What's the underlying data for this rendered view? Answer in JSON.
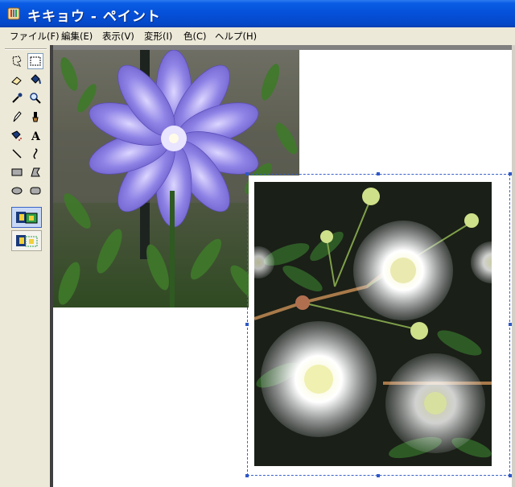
{
  "window": {
    "title": "キキョウ - ペイント"
  },
  "menu": [
    "ファイル(F)",
    "編集(E)",
    "表示(V)",
    "変形(I)",
    "色(C)",
    "ヘルプ(H)"
  ],
  "tools": [
    {
      "name": "free-select-icon",
      "glyph": "☆"
    },
    {
      "name": "rect-select-icon",
      "glyph": "▭"
    },
    {
      "name": "eraser-icon",
      "glyph": "◇"
    },
    {
      "name": "fill-icon",
      "glyph": "◆"
    },
    {
      "name": "color-picker-icon",
      "glyph": "∕"
    },
    {
      "name": "magnifier-icon",
      "glyph": "⚲"
    },
    {
      "name": "pencil-icon",
      "glyph": "✎"
    },
    {
      "name": "brush-icon",
      "glyph": "♜"
    },
    {
      "name": "airbrush-icon",
      "glyph": "◆"
    },
    {
      "name": "text-icon",
      "glyph": "A"
    },
    {
      "name": "line-icon",
      "glyph": "╲"
    },
    {
      "name": "curve-icon",
      "glyph": "∫"
    },
    {
      "name": "rectangle-icon",
      "glyph": "▭"
    },
    {
      "name": "polygon-icon",
      "glyph": "◺"
    },
    {
      "name": "ellipse-icon",
      "glyph": "⬭"
    },
    {
      "name": "rounded-rect-icon",
      "glyph": "▢"
    }
  ],
  "colors": {
    "title_gradient_top": "#2f7cf0",
    "title_gradient_bottom": "#0448c8",
    "selection_border": "#3a63c8",
    "canvas_bg": "#ffffff",
    "workspace_bg": "#808080"
  }
}
